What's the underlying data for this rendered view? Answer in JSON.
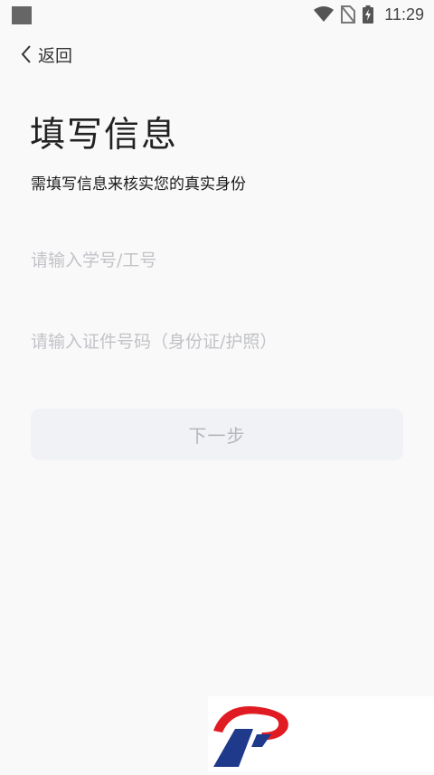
{
  "status_bar": {
    "time": "11:29",
    "icons": [
      "wifi-icon",
      "no-sim-icon",
      "battery-charging-icon"
    ]
  },
  "nav": {
    "back_label": "返回",
    "back_icon": "chevron-left-icon"
  },
  "page": {
    "title": "填写信息",
    "subtitle": "需填写信息来核实您的真实身份"
  },
  "form": {
    "id_placeholder": "请输入学号/工号",
    "id_value": "",
    "doc_placeholder": "请输入证件号码（身份证/护照）",
    "doc_value": "",
    "next_label": "下一步"
  },
  "colors": {
    "background": "#f9f9fa",
    "placeholder": "#c2c3c7",
    "button_bg": "#f1f2f5",
    "button_text": "#b4b6bc",
    "logo_red": "#e01b22",
    "logo_blue": "#1f3a8a"
  }
}
